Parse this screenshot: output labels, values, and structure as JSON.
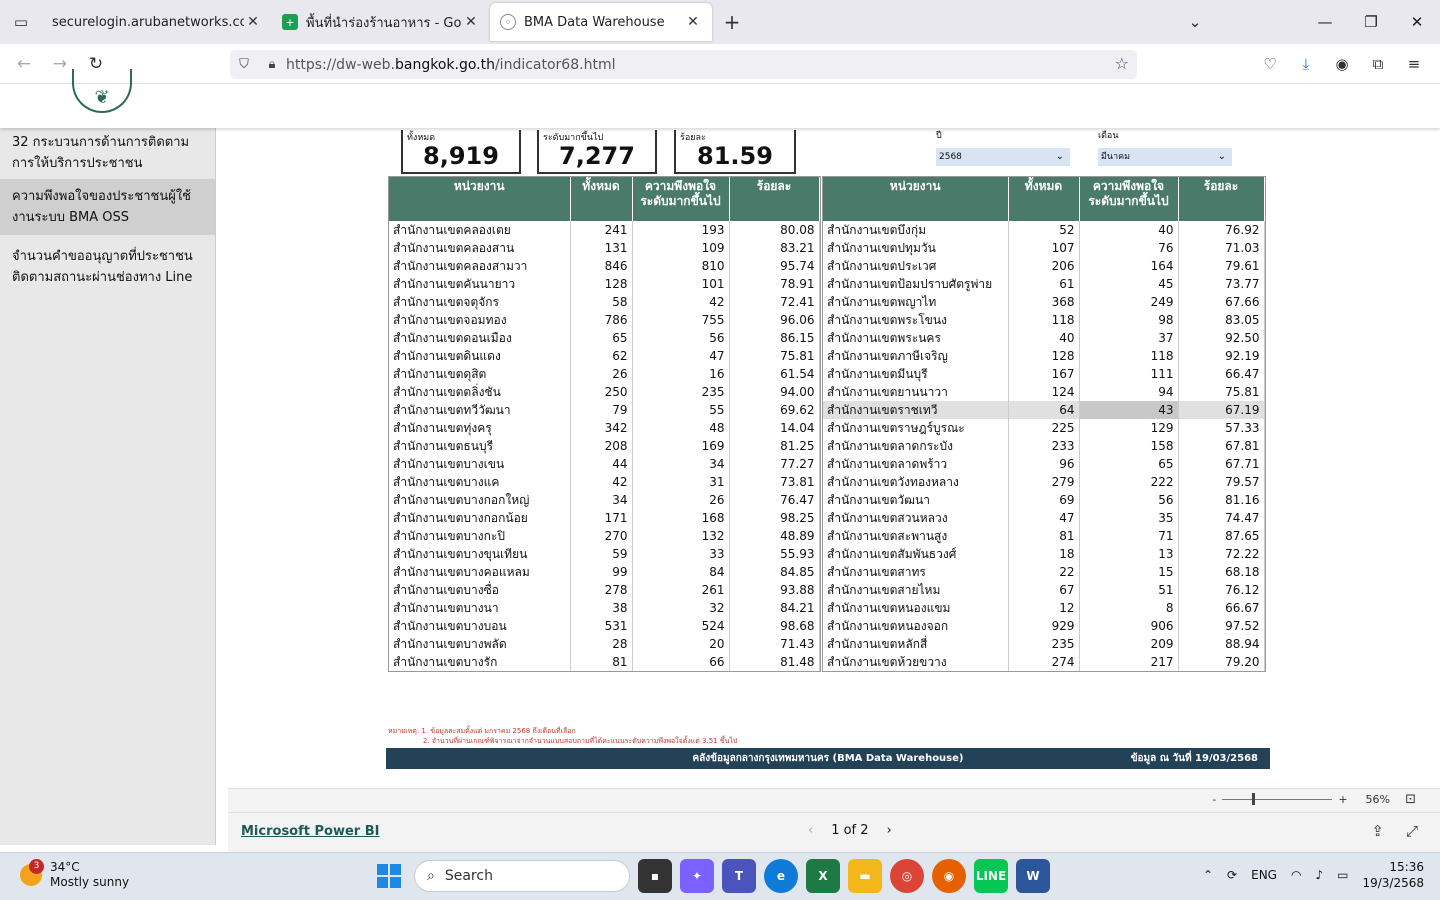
{
  "browser": {
    "tabs": [
      {
        "title": "securelogin.arubanetworks.com/cgi",
        "favicon": "tab-list-icon"
      },
      {
        "title": "พื้นที่นำร่องร้านอาหาร - Google ชีต",
        "favicon": "sheets-icon"
      },
      {
        "title": "BMA Data Warehouse",
        "favicon": "globe-icon"
      }
    ],
    "url_prefix": "https://dw-web.",
    "url_host": "bangkok.go.th",
    "url_path": "/indicator68.html"
  },
  "sidebar": {
    "items": [
      {
        "label": "32 กระบวนการด้านการติดตามการให้บริการประชาชน"
      },
      {
        "label": "ความพึงพอใจของประชาชนผู้ใช้งานระบบ BMA OSS"
      },
      {
        "label": "จำนวนคำขออนุญาตที่ประชาชนติดตามสถานะผ่านช่องทาง Line"
      }
    ]
  },
  "cards": [
    {
      "label": "ทั้งหมด",
      "value": "8,919"
    },
    {
      "label": "ระดับมากขึ้นไป",
      "value": "7,277"
    },
    {
      "label": "ร้อยละ",
      "value": "81.59"
    }
  ],
  "slicers": {
    "year_label": "ปี",
    "year_value": "2568",
    "month_label": "เดือน",
    "month_value": "มีนาคม"
  },
  "table": {
    "headers": [
      "หน่วยงาน",
      "ทั้งหมด",
      "ความพึงพอใจระดับมากขึ้นไป",
      "ร้อยละ"
    ],
    "left": [
      [
        "สำนักงานเขตคลองเตย",
        "241",
        "193",
        "80.08"
      ],
      [
        "สำนักงานเขตคลองสาน",
        "131",
        "109",
        "83.21"
      ],
      [
        "สำนักงานเขตคลองสามวา",
        "846",
        "810",
        "95.74"
      ],
      [
        "สำนักงานเขตคันนายาว",
        "128",
        "101",
        "78.91"
      ],
      [
        "สำนักงานเขตจตุจักร",
        "58",
        "42",
        "72.41"
      ],
      [
        "สำนักงานเขตจอมทอง",
        "786",
        "755",
        "96.06"
      ],
      [
        "สำนักงานเขตดอนเมือง",
        "65",
        "56",
        "86.15"
      ],
      [
        "สำนักงานเขตดินแดง",
        "62",
        "47",
        "75.81"
      ],
      [
        "สำนักงานเขตดุสิต",
        "26",
        "16",
        "61.54"
      ],
      [
        "สำนักงานเขตตลิ่งชัน",
        "250",
        "235",
        "94.00"
      ],
      [
        "สำนักงานเขตทวีวัฒนา",
        "79",
        "55",
        "69.62"
      ],
      [
        "สำนักงานเขตทุ่งครุ",
        "342",
        "48",
        "14.04"
      ],
      [
        "สำนักงานเขตธนบุรี",
        "208",
        "169",
        "81.25"
      ],
      [
        "สำนักงานเขตบางเขน",
        "44",
        "34",
        "77.27"
      ],
      [
        "สำนักงานเขตบางแค",
        "42",
        "31",
        "73.81"
      ],
      [
        "สำนักงานเขตบางกอกใหญ่",
        "34",
        "26",
        "76.47"
      ],
      [
        "สำนักงานเขตบางกอกน้อย",
        "171",
        "168",
        "98.25"
      ],
      [
        "สำนักงานเขตบางกะปิ",
        "270",
        "132",
        "48.89"
      ],
      [
        "สำนักงานเขตบางขุนเทียน",
        "59",
        "33",
        "55.93"
      ],
      [
        "สำนักงานเขตบางคอแหลม",
        "99",
        "84",
        "84.85"
      ],
      [
        "สำนักงานเขตบางซื่อ",
        "278",
        "261",
        "93.88"
      ],
      [
        "สำนักงานเขตบางนา",
        "38",
        "32",
        "84.21"
      ],
      [
        "สำนักงานเขตบางบอน",
        "531",
        "524",
        "98.68"
      ],
      [
        "สำนักงานเขตบางพลัด",
        "28",
        "20",
        "71.43"
      ],
      [
        "สำนักงานเขตบางรัก",
        "81",
        "66",
        "81.48"
      ]
    ],
    "right": [
      [
        "สำนักงานเขตบึงกุ่ม",
        "52",
        "40",
        "76.92"
      ],
      [
        "สำนักงานเขตปทุมวัน",
        "107",
        "76",
        "71.03"
      ],
      [
        "สำนักงานเขตประเวศ",
        "206",
        "164",
        "79.61"
      ],
      [
        "สำนักงานเขตป้อมปราบศัตรูพ่าย",
        "61",
        "45",
        "73.77"
      ],
      [
        "สำนักงานเขตพญาไท",
        "368",
        "249",
        "67.66"
      ],
      [
        "สำนักงานเขตพระโขนง",
        "118",
        "98",
        "83.05"
      ],
      [
        "สำนักงานเขตพระนคร",
        "40",
        "37",
        "92.50"
      ],
      [
        "สำนักงานเขตภาษีเจริญ",
        "128",
        "118",
        "92.19"
      ],
      [
        "สำนักงานเขตมีนบุรี",
        "167",
        "111",
        "66.47"
      ],
      [
        "สำนักงานเขตยานนาวา",
        "124",
        "94",
        "75.81"
      ],
      [
        "สำนักงานเขตราชเทวี",
        "64",
        "43",
        "67.19"
      ],
      [
        "สำนักงานเขตราษฎร์บูรณะ",
        "225",
        "129",
        "57.33"
      ],
      [
        "สำนักงานเขตลาดกระบัง",
        "233",
        "158",
        "67.81"
      ],
      [
        "สำนักงานเขตลาดพร้าว",
        "96",
        "65",
        "67.71"
      ],
      [
        "สำนักงานเขตวังทองหลาง",
        "279",
        "222",
        "79.57"
      ],
      [
        "สำนักงานเขตวัฒนา",
        "69",
        "56",
        "81.16"
      ],
      [
        "สำนักงานเขตสวนหลวง",
        "47",
        "35",
        "74.47"
      ],
      [
        "สำนักงานเขตสะพานสูง",
        "81",
        "71",
        "87.65"
      ],
      [
        "สำนักงานเขตสัมพันธวงศ์",
        "18",
        "13",
        "72.22"
      ],
      [
        "สำนักงานเขตสาทร",
        "22",
        "15",
        "68.18"
      ],
      [
        "สำนักงานเขตสายไหม",
        "67",
        "51",
        "76.12"
      ],
      [
        "สำนักงานเขตหนองแขม",
        "12",
        "8",
        "66.67"
      ],
      [
        "สำนักงานเขตหนองจอก",
        "929",
        "906",
        "97.52"
      ],
      [
        "สำนักงานเขตหลักสี่",
        "235",
        "209",
        "88.94"
      ],
      [
        "สำนักงานเขตห้วยขวาง",
        "274",
        "217",
        "79.20"
      ]
    ]
  },
  "notes": {
    "line1": "หมายเหตุ: 1. ข้อมูลสะสมตั้งแต่ มกราคม 2568 ถึงเดือนที่เลือก",
    "line2": "2. จำนวนที่ผ่านเกณฑ์พิจารณาจากจำนวนแบบสอบถามที่ได้คะแนนระดับความพึงพอใจตั้งแต่ 3.51 ขึ้นไป"
  },
  "footer_band": {
    "center": "คลังข้อมูลกลางกรุงเทพมหานคร (BMA Data Warehouse)",
    "right": "ข้อมูล ณ วันที่  19/03/2568"
  },
  "zoom": {
    "minus": "-",
    "plus": "+",
    "value": "56%"
  },
  "powerbi": {
    "brand": "Microsoft Power BI",
    "page": "1 of 2"
  },
  "taskbar": {
    "weather_temp": "34°C",
    "weather_desc": "Mostly sunny",
    "weather_badge": "3",
    "search": "Search",
    "lang": "ENG",
    "time": "15:36",
    "date": "19/3/2568"
  }
}
